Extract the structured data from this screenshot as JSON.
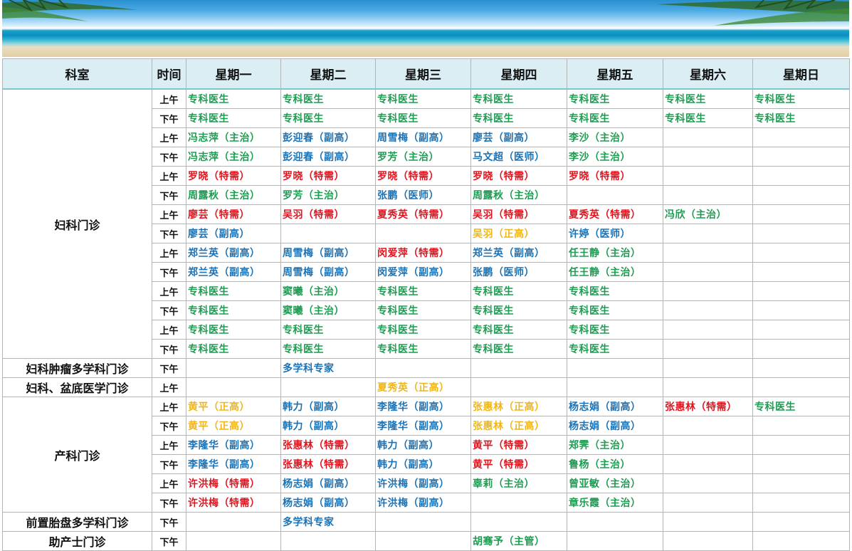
{
  "colors": {
    "green": "#1e9c52",
    "blue": "#1b72b5",
    "red": "#e0141e",
    "gold": "#efb61b",
    "header_bg": "#daeef3"
  },
  "header": [
    "科室",
    "时间",
    "星期一",
    "星期二",
    "星期三",
    "星期四",
    "星期五",
    "星期六",
    "星期日"
  ],
  "groups": [
    {
      "dept": "妇科门诊",
      "rows": [
        {
          "period": "上午",
          "cells": [
            [
              "专科医生",
              "green"
            ],
            [
              "专科医生",
              "green"
            ],
            [
              "专科医生",
              "green"
            ],
            [
              "专科医生",
              "green"
            ],
            [
              "专科医生",
              "green"
            ],
            [
              "专科医生",
              "green"
            ],
            [
              "专科医生",
              "green"
            ]
          ]
        },
        {
          "period": "下午",
          "cells": [
            [
              "专科医生",
              "green"
            ],
            [
              "专科医生",
              "green"
            ],
            [
              "专科医生",
              "green"
            ],
            [
              "专科医生",
              "green"
            ],
            [
              "专科医生",
              "green"
            ],
            [
              "专科医生",
              "green"
            ],
            [
              "专科医生",
              "green"
            ]
          ]
        },
        {
          "period": "上午",
          "cells": [
            [
              "冯志萍（主治）",
              "green"
            ],
            [
              "彭迎春（副高）",
              "blue"
            ],
            [
              "周雪梅（副高）",
              "blue"
            ],
            [
              "廖芸（副高）",
              "blue"
            ],
            [
              "李沙（主治）",
              "green"
            ],
            [
              "",
              ""
            ],
            [
              "",
              ""
            ]
          ]
        },
        {
          "period": "下午",
          "cells": [
            [
              "冯志萍（主治）",
              "green"
            ],
            [
              "彭迎春（副高）",
              "blue"
            ],
            [
              "罗芳（主治）",
              "green"
            ],
            [
              "马文超（医师）",
              "blue"
            ],
            [
              "李沙（主治）",
              "green"
            ],
            [
              "",
              ""
            ],
            [
              "",
              ""
            ]
          ]
        },
        {
          "period": "上午",
          "cells": [
            [
              "罗晓（特需）",
              "red"
            ],
            [
              "罗晓（特需）",
              "red"
            ],
            [
              "罗晓（特需）",
              "red"
            ],
            [
              "罗晓（特需）",
              "red"
            ],
            [
              "罗晓（特需）",
              "red"
            ],
            [
              "",
              ""
            ],
            [
              "",
              ""
            ]
          ]
        },
        {
          "period": "下午",
          "cells": [
            [
              "周露秋（主治）",
              "green"
            ],
            [
              "罗芳（主治）",
              "green"
            ],
            [
              "张鹏（医师）",
              "blue"
            ],
            [
              "周露秋（主治）",
              "green"
            ],
            [
              "",
              ""
            ],
            [
              "",
              ""
            ],
            [
              "",
              ""
            ]
          ]
        },
        {
          "period": "上午",
          "cells": [
            [
              "廖芸（特需）",
              "red"
            ],
            [
              "吴羽（特需）",
              "red"
            ],
            [
              "夏秀英（特需）",
              "red"
            ],
            [
              "吴羽（特需）",
              "red"
            ],
            [
              "夏秀英（特需）",
              "red"
            ],
            [
              "冯欣（主治）",
              "green"
            ],
            [
              "",
              ""
            ]
          ]
        },
        {
          "period": "下午",
          "cells": [
            [
              "廖芸（副高）",
              "blue"
            ],
            [
              "",
              ""
            ],
            [
              "",
              ""
            ],
            [
              "吴羽（正高）",
              "gold"
            ],
            [
              "许婷（医师）",
              "blue"
            ],
            [
              "",
              ""
            ],
            [
              "",
              ""
            ]
          ]
        },
        {
          "period": "上午",
          "cells": [
            [
              "郑兰英（副高）",
              "blue"
            ],
            [
              "周雪梅（副高）",
              "blue"
            ],
            [
              "闵爱萍（特需）",
              "red"
            ],
            [
              "郑兰英（副高）",
              "blue"
            ],
            [
              "任王静（主治）",
              "green"
            ],
            [
              "",
              ""
            ],
            [
              "",
              ""
            ]
          ]
        },
        {
          "period": "下午",
          "cells": [
            [
              "郑兰英（副高）",
              "blue"
            ],
            [
              "周雪梅（副高）",
              "blue"
            ],
            [
              "闵爱萍（副高）",
              "blue"
            ],
            [
              "张鹏（医师）",
              "blue"
            ],
            [
              "任王静（主治）",
              "green"
            ],
            [
              "",
              ""
            ],
            [
              "",
              ""
            ]
          ]
        },
        {
          "period": "上午",
          "cells": [
            [
              "专科医生",
              "green"
            ],
            [
              "窦曦（主治）",
              "green"
            ],
            [
              "专科医生",
              "green"
            ],
            [
              "专科医生",
              "green"
            ],
            [
              "专科医生",
              "green"
            ],
            [
              "",
              ""
            ],
            [
              "",
              ""
            ]
          ]
        },
        {
          "period": "下午",
          "cells": [
            [
              "专科医生",
              "green"
            ],
            [
              "窦曦（主治）",
              "green"
            ],
            [
              "专科医生",
              "green"
            ],
            [
              "专科医生",
              "green"
            ],
            [
              "专科医生",
              "green"
            ],
            [
              "",
              ""
            ],
            [
              "",
              ""
            ]
          ]
        },
        {
          "period": "上午",
          "cells": [
            [
              "专科医生",
              "green"
            ],
            [
              "专科医生",
              "green"
            ],
            [
              "专科医生",
              "green"
            ],
            [
              "专科医生",
              "green"
            ],
            [
              "专科医生",
              "green"
            ],
            [
              "",
              ""
            ],
            [
              "",
              ""
            ]
          ]
        },
        {
          "period": "下午",
          "cells": [
            [
              "专科医生",
              "green"
            ],
            [
              "专科医生",
              "green"
            ],
            [
              "专科医生",
              "green"
            ],
            [
              "专科医生",
              "green"
            ],
            [
              "专科医生",
              "green"
            ],
            [
              "",
              ""
            ],
            [
              "",
              ""
            ]
          ]
        }
      ]
    },
    {
      "dept": "妇科肿瘤多学科门诊",
      "rows": [
        {
          "period": "下午",
          "cells": [
            [
              "",
              ""
            ],
            [
              "多学科专家",
              "blue"
            ],
            [
              "",
              ""
            ],
            [
              "",
              ""
            ],
            [
              "",
              ""
            ],
            [
              "",
              ""
            ],
            [
              "",
              ""
            ]
          ]
        }
      ]
    },
    {
      "dept": "妇科、盆底医学门诊",
      "rows": [
        {
          "period": "上午",
          "cells": [
            [
              "",
              ""
            ],
            [
              "",
              ""
            ],
            [
              "夏秀英（正高）",
              "gold"
            ],
            [
              "",
              ""
            ],
            [
              "",
              ""
            ],
            [
              "",
              ""
            ],
            [
              "",
              ""
            ]
          ]
        }
      ]
    },
    {
      "dept": "产科门诊",
      "rows": [
        {
          "period": "上午",
          "cells": [
            [
              "黄平（正高）",
              "gold"
            ],
            [
              "韩力（副高）",
              "blue"
            ],
            [
              "李隆华（副高）",
              "blue"
            ],
            [
              "张惠林（正高）",
              "gold"
            ],
            [
              "杨志娟（副高）",
              "blue"
            ],
            [
              "张惠林（特需）",
              "red"
            ],
            [
              "专科医生",
              "green"
            ]
          ]
        },
        {
          "period": "下午",
          "cells": [
            [
              "黄平（正高）",
              "gold"
            ],
            [
              "韩力（副高）",
              "blue"
            ],
            [
              "李隆华（副高）",
              "blue"
            ],
            [
              "张惠林（正高）",
              "gold"
            ],
            [
              "杨志娟（副高）",
              "blue"
            ],
            [
              "",
              ""
            ],
            [
              "",
              ""
            ]
          ]
        },
        {
          "period": "上午",
          "cells": [
            [
              "李隆华（副高）",
              "blue"
            ],
            [
              "张惠林（特需）",
              "red"
            ],
            [
              "韩力（副高）",
              "blue"
            ],
            [
              "黄平（特需）",
              "red"
            ],
            [
              "郑霁（主治）",
              "green"
            ],
            [
              "",
              ""
            ],
            [
              "",
              ""
            ]
          ]
        },
        {
          "period": "下午",
          "cells": [
            [
              "李隆华（副高）",
              "blue"
            ],
            [
              "张惠林（特需）",
              "red"
            ],
            [
              "韩力（副高）",
              "blue"
            ],
            [
              "黄平（特需）",
              "red"
            ],
            [
              "鲁杨（主治）",
              "green"
            ],
            [
              "",
              ""
            ],
            [
              "",
              ""
            ]
          ]
        },
        {
          "period": "上午",
          "cells": [
            [
              "许洪梅（特需）",
              "red"
            ],
            [
              "杨志娟（副高）",
              "blue"
            ],
            [
              "许洪梅（副高）",
              "blue"
            ],
            [
              "辜莉（主治）",
              "green"
            ],
            [
              "曾亚敏（主治）",
              "green"
            ],
            [
              "",
              ""
            ],
            [
              "",
              ""
            ]
          ]
        },
        {
          "period": "下午",
          "cells": [
            [
              "许洪梅（特需）",
              "red"
            ],
            [
              "杨志娟（副高）",
              "blue"
            ],
            [
              "许洪梅（副高）",
              "blue"
            ],
            [
              "",
              ""
            ],
            [
              "章乐霞（主治）",
              "green"
            ],
            [
              "",
              ""
            ],
            [
              "",
              ""
            ]
          ]
        }
      ]
    },
    {
      "dept": "前置胎盘多学科门诊",
      "rows": [
        {
          "period": "下午",
          "cells": [
            [
              "",
              ""
            ],
            [
              "多学科专家",
              "blue"
            ],
            [
              "",
              ""
            ],
            [
              "",
              ""
            ],
            [
              "",
              ""
            ],
            [
              "",
              ""
            ],
            [
              "",
              ""
            ]
          ]
        }
      ]
    },
    {
      "dept": "助产士门诊",
      "rows": [
        {
          "period": "下午",
          "cells": [
            [
              "",
              ""
            ],
            [
              "",
              ""
            ],
            [
              "",
              ""
            ],
            [
              "胡骞予（主管）",
              "green"
            ],
            [
              "",
              ""
            ],
            [
              "",
              ""
            ],
            [
              "",
              ""
            ]
          ]
        }
      ]
    }
  ]
}
